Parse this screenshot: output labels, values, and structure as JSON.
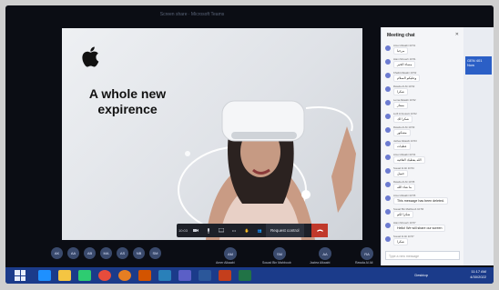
{
  "window": {
    "title": "Screen share · Microsoft Teams"
  },
  "slide": {
    "headline_1": "A whole new",
    "headline_2": "expirence"
  },
  "presenter": {
    "label": ""
  },
  "controls": {
    "items": [
      "10:03",
      "cam",
      "mic",
      "share",
      "more",
      "react",
      "people"
    ],
    "request_control": "Request control"
  },
  "participants": [
    {
      "initials": "AK"
    },
    {
      "initials": "AA"
    },
    {
      "initials": "AB"
    },
    {
      "initials": "MA"
    },
    {
      "initials": "AS"
    },
    {
      "initials": "NB"
    },
    {
      "initials": "SM"
    },
    {
      "initials": "AM",
      "name": "Amer Alkaabi"
    },
    {
      "initials": "SM",
      "name": "Souad Bin Mahboob"
    },
    {
      "initials": "AA",
      "name": "Jazlea Alkaabi"
    },
    {
      "initials": "RA",
      "name": "Rawda Al Ali"
    }
  ],
  "chat": {
    "title": "Meeting chat",
    "messages": [
      {
        "meta": "Amer Alkaabi  10:51",
        "text": "مرحبا"
      },
      {
        "meta": "Hiam Mroueh  10:51",
        "text": "مساء الخير"
      },
      {
        "meta": "Khalid Alkaabi  10:52",
        "text": "وعليكم السلام"
      },
      {
        "meta": "Rawda Al Ali  10:52",
        "text": "شكرا"
      },
      {
        "meta": "Lema Alkaabi  10:52",
        "text": "ممتاز"
      },
      {
        "meta": "Lutfi Al Hosani  10:52",
        "text": "شكرا لك"
      },
      {
        "meta": "Rawda Al Ali  10:53",
        "text": "مشكور"
      },
      {
        "meta": "Jazlea Alkaabi  10:53",
        "text": "عطيات"
      },
      {
        "meta": "Amer Alkaabi  10:54",
        "text": "الله يعطيك العافية"
      },
      {
        "meta": "Souad Al Ali  10:54",
        "text": "جميل"
      },
      {
        "meta": "Rawda Al Ali  10:55",
        "text": "ما شاء الله"
      },
      {
        "meta": "Amer Alkaabi  10:55",
        "text": "This message has been deleted."
      },
      {
        "meta": "Souad Bin Mahboob  10:56",
        "text": "شكرا لكم"
      },
      {
        "meta": "Hiam Mroueh  10:57",
        "text": "Hello! We will share our screen"
      },
      {
        "meta": "Souad Al Ali  10:57",
        "text": "شكرا"
      }
    ],
    "input_placeholder": "Type a new message"
  },
  "side": {
    "card_title": "GEN 401",
    "card_sub": "Now"
  },
  "taskbar": {
    "icons": [
      "start-menu",
      "ie",
      "file-explorer",
      "store",
      "chrome",
      "firefox",
      "office",
      "mail",
      "teams",
      "word",
      "powerpoint",
      "excel"
    ],
    "desktop_label": "Desktop",
    "time": "11:17 AM",
    "date": "4/30/2022",
    "lang": "ENG"
  },
  "colors": {
    "taskbar": "#1b3b8a",
    "leave": "#c0392b",
    "avatar": "#3a4a6d",
    "chat_bg": "#f4f5f8"
  }
}
